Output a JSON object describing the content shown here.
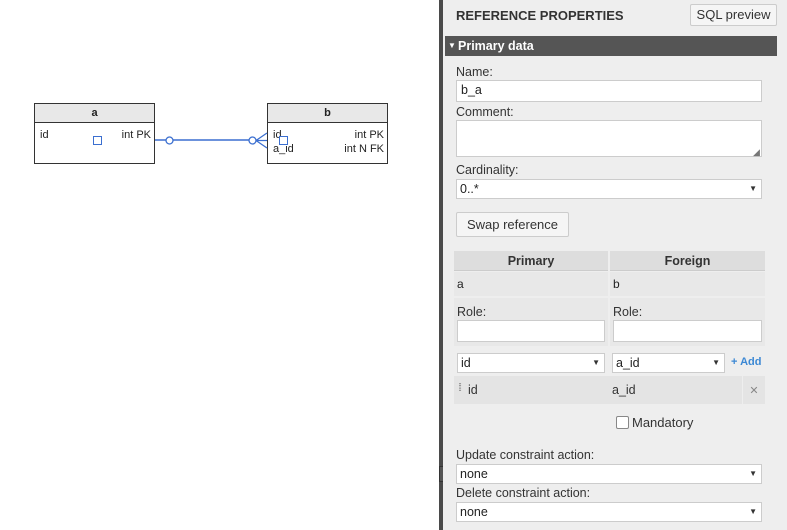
{
  "diagram": {
    "table_a": {
      "name": "a",
      "columns": [
        {
          "name": "id",
          "type": "int PK"
        }
      ]
    },
    "table_b": {
      "name": "b",
      "columns": [
        {
          "name": "id",
          "type": "int PK"
        },
        {
          "name": "a_id",
          "type": "int N FK"
        }
      ]
    }
  },
  "panel": {
    "title": "REFERENCE PROPERTIES",
    "sql_preview_label": "SQL preview",
    "section_label": "Primary data",
    "name_label": "Name:",
    "name_value": "b_a",
    "comment_label": "Comment:",
    "comment_value": "",
    "cardinality_label": "Cardinality:",
    "cardinality_value": "0..*",
    "swap_label": "Swap reference",
    "primary_header": "Primary",
    "foreign_header": "Foreign",
    "primary_table": "a",
    "foreign_table": "b",
    "role_label": "Role:",
    "primary_role": "",
    "foreign_role": "",
    "primary_column_select": "id",
    "foreign_column_select": "a_id",
    "add_label": "+ Add",
    "pair": {
      "primary": "id",
      "foreign": "a_id"
    },
    "remove_glyph": "✕",
    "mandatory_label": "Mandatory",
    "update_label": "Update constraint action:",
    "update_value": "none",
    "delete_label": "Delete constraint action:",
    "delete_value": "none"
  },
  "colors": {
    "selection": "#3b6fd0",
    "section_bg": "#555555",
    "add_link": "#3b88d4"
  }
}
